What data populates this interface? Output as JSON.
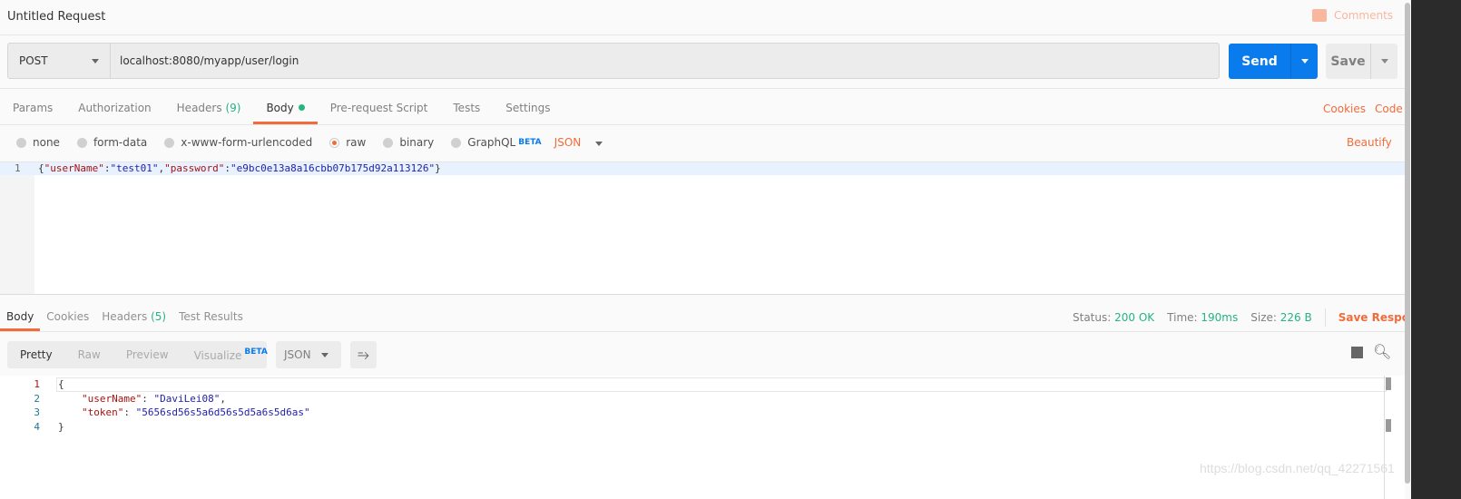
{
  "title": "Untitled Request",
  "comments": "Comments",
  "request": {
    "method": "POST",
    "url": "localhost:8080/myapp/user/login",
    "send": "Send",
    "save": "Save"
  },
  "tabs": [
    {
      "label": "Params"
    },
    {
      "label": "Authorization"
    },
    {
      "label": "Headers",
      "count": "(9)"
    },
    {
      "label": "Body"
    },
    {
      "label": "Pre-request Script"
    },
    {
      "label": "Tests"
    },
    {
      "label": "Settings"
    }
  ],
  "links": {
    "cookies": "Cookies",
    "code": "Code",
    "beautify": "Beautify"
  },
  "body_options": [
    "none",
    "form-data",
    "x-www-form-urlencoded",
    "raw",
    "binary",
    "GraphQL"
  ],
  "selected_option": "raw",
  "beta": "BETA",
  "body_format": "JSON",
  "request_body": {
    "line": "1",
    "k1": "\"userName\"",
    "v1": "\"test01\"",
    "k2": "\"password\"",
    "v2": "\"e9bc0e13a8a16cbb07b175d92a113126\""
  },
  "response_tabs": [
    {
      "label": "Body"
    },
    {
      "label": "Cookies"
    },
    {
      "label": "Headers",
      "count": "(5)"
    },
    {
      "label": "Test Results"
    }
  ],
  "status": {
    "status_label": "Status:",
    "status": "200 OK",
    "time_label": "Time:",
    "time": "190ms",
    "size_label": "Size:",
    "size": "226 B",
    "save_response": "Save Response"
  },
  "view_modes": [
    "Pretty",
    "Raw",
    "Preview",
    "Visualize"
  ],
  "response_format": "JSON",
  "response_body": {
    "lines": [
      "1",
      "2",
      "3",
      "4"
    ],
    "k1": "\"userName\"",
    "v1": "\"DaviLei08\"",
    "k2": "\"token\"",
    "v2": "\"5656sd56s5a6d56s5d5a6s5d6as\""
  },
  "watermark": "https://blog.csdn.net/qq_42271561",
  "colors": {
    "accent": "#f26b3a",
    "send": "#097bed",
    "success": "#26b47f"
  }
}
